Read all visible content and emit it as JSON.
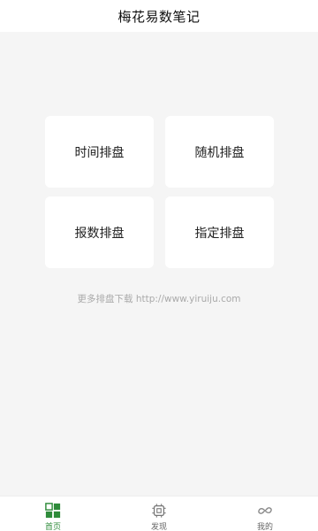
{
  "header": {
    "title": "梅花易数笔记"
  },
  "cards": [
    {
      "label": "时间排盘"
    },
    {
      "label": "随机排盘"
    },
    {
      "label": "报数排盘"
    },
    {
      "label": "指定排盘"
    }
  ],
  "footer_text": "更多排盘下载 http://www.yiruiju.com",
  "tabbar": {
    "items": [
      {
        "label": "首页",
        "icon": "grid-icon",
        "active": true
      },
      {
        "label": "发现",
        "icon": "chip-icon",
        "active": false
      },
      {
        "label": "我的",
        "icon": "link-icon",
        "active": false
      }
    ]
  },
  "colors": {
    "accent": "#2e8b3a",
    "background": "#f5f5f5",
    "card": "#ffffff"
  }
}
